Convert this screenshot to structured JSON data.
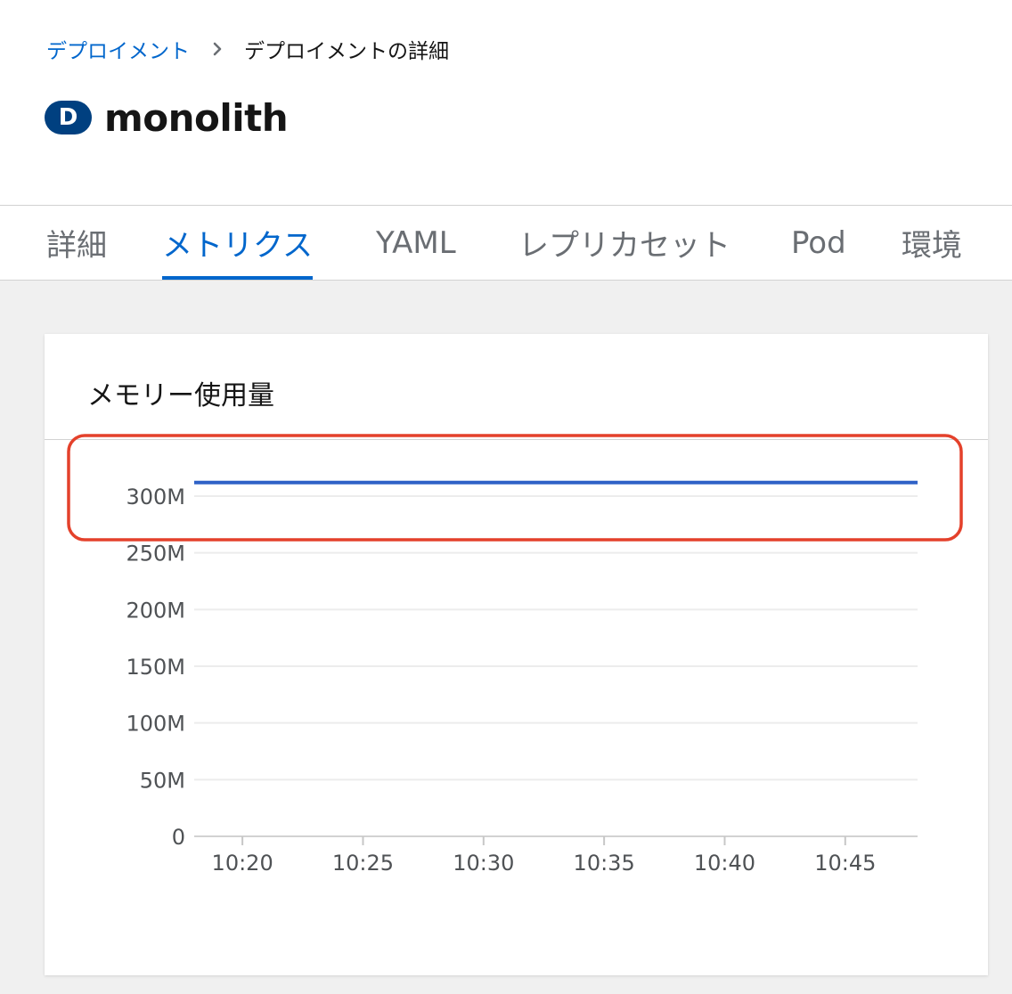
{
  "breadcrumb": {
    "parent_label": "デプロイメント",
    "current_label": "デプロイメントの詳細"
  },
  "resource": {
    "badge": "D",
    "name": "monolith",
    "badge_color": "#004080"
  },
  "tabs": [
    {
      "label": "詳細",
      "active": false
    },
    {
      "label": "メトリクス",
      "active": true
    },
    {
      "label": "YAML",
      "active": false
    },
    {
      "label": "レプリカセット",
      "active": false
    },
    {
      "label": "Pod",
      "active": false
    },
    {
      "label": "環境",
      "active": false
    }
  ],
  "colors": {
    "accent": "#0066cc",
    "series_line": "#2f62c7",
    "highlight": "#e4412b"
  },
  "memory_card": {
    "title": "メモリー使用量",
    "chart_data": {
      "type": "line",
      "title": "メモリー使用量",
      "xlabel": "",
      "ylabel": "",
      "ylim": [
        0,
        300
      ],
      "y_unit": "M",
      "yticks": [
        {
          "value": 0,
          "label": "0"
        },
        {
          "value": 50,
          "label": "50M"
        },
        {
          "value": 100,
          "label": "100M"
        },
        {
          "value": 150,
          "label": "150M"
        },
        {
          "value": 200,
          "label": "200M"
        },
        {
          "value": 250,
          "label": "250M"
        },
        {
          "value": 300,
          "label": "300M"
        }
      ],
      "xlim": [
        "10:18",
        "10:48"
      ],
      "xticks": [
        "10:20",
        "10:25",
        "10:30",
        "10:35",
        "10:40",
        "10:45"
      ],
      "grid": true,
      "series": [
        {
          "x": [
            "10:18",
            "10:48"
          ],
          "values": [
            312,
            312
          ]
        }
      ],
      "annotation": "red rounded rectangle highlighting the top of the chart around the 300M line"
    }
  }
}
